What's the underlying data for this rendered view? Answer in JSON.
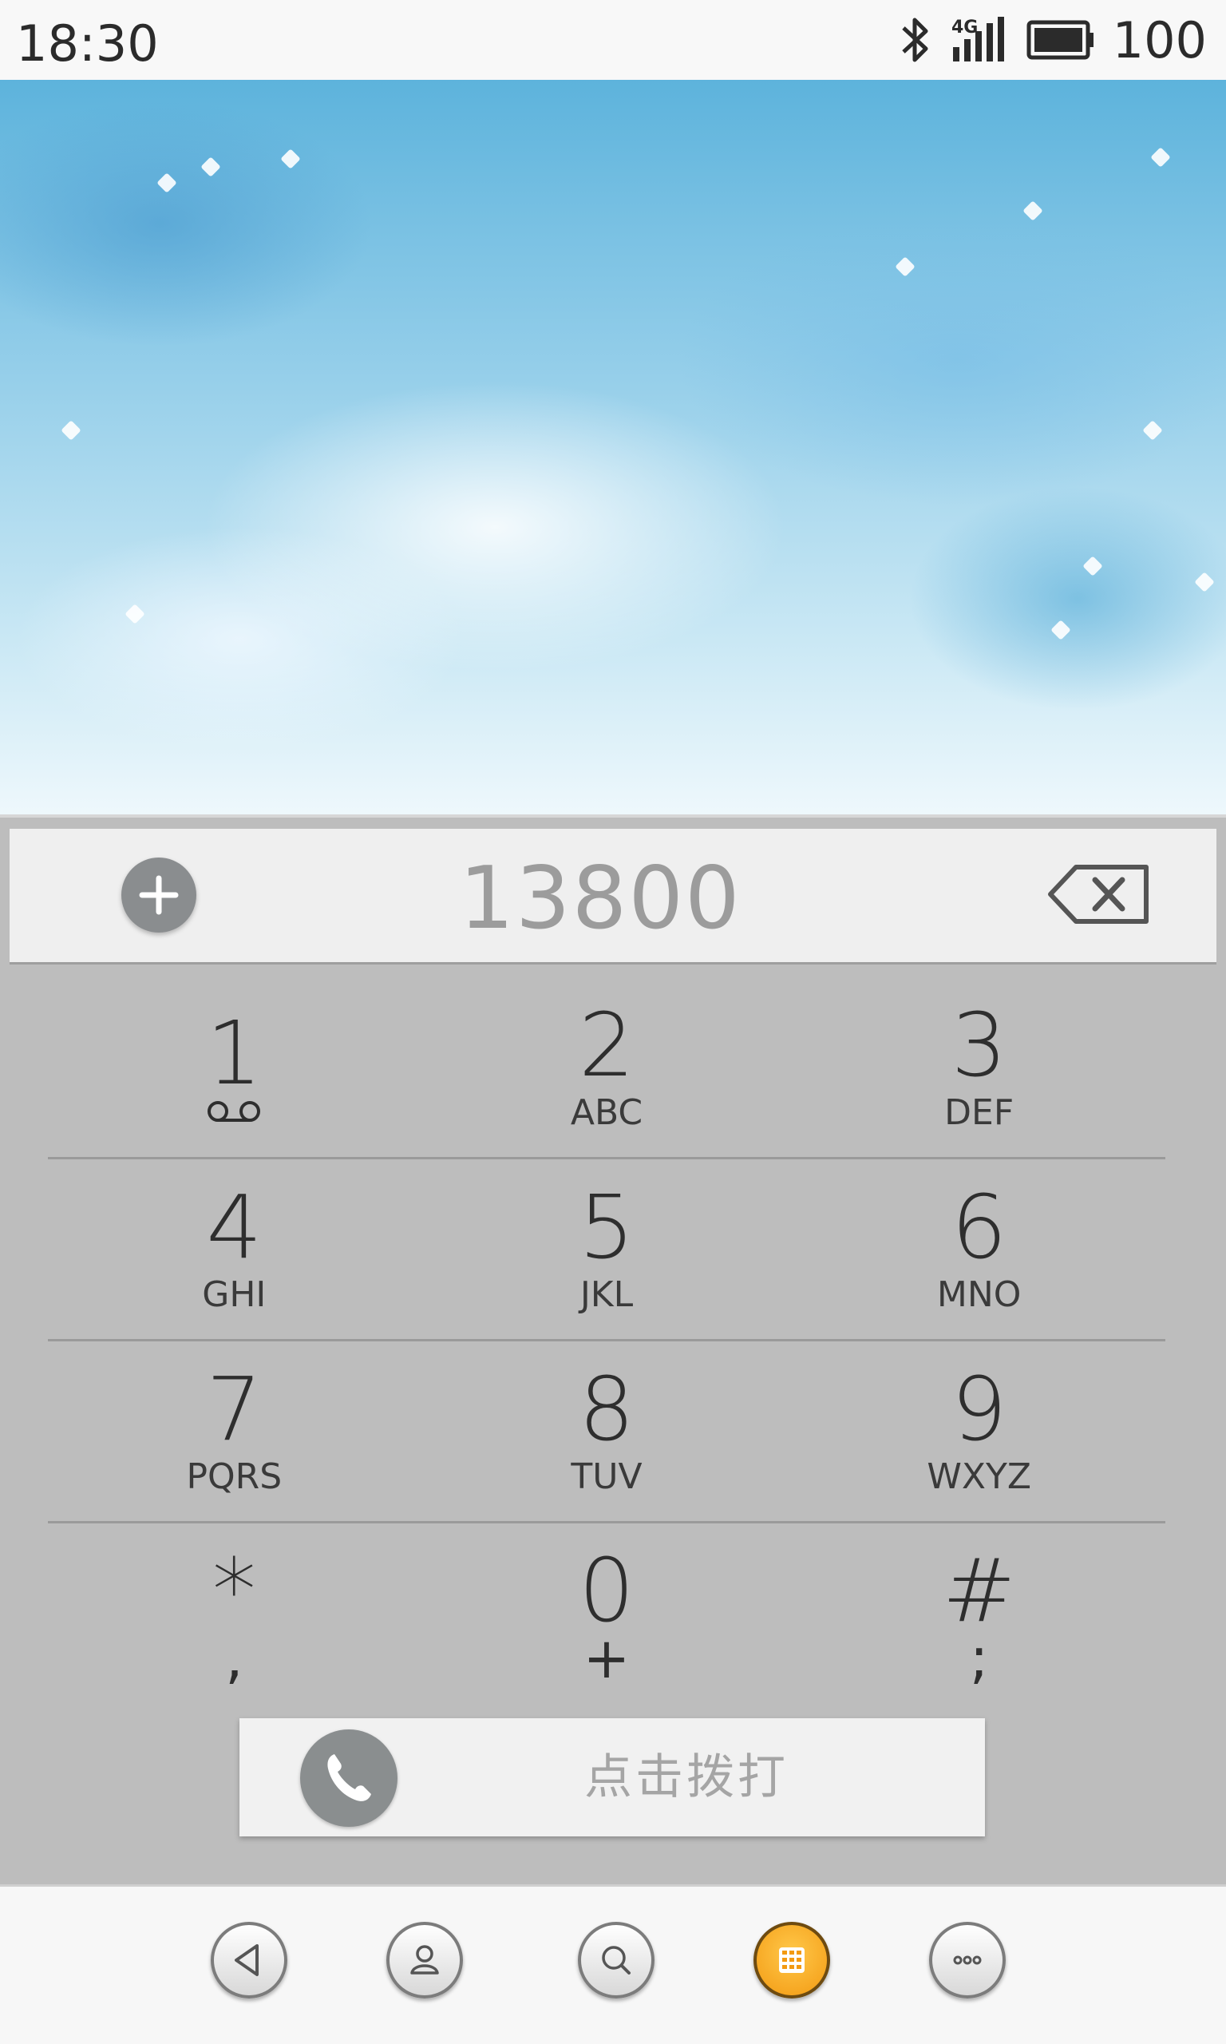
{
  "status_bar": {
    "time": "18:30",
    "network": "4G",
    "battery": "100",
    "icons": [
      "bluetooth-icon",
      "signal-icon",
      "battery-icon"
    ]
  },
  "dialer": {
    "number": "13800",
    "add_icon": "plus-circle-icon",
    "backspace_icon": "backspace-icon",
    "keys": [
      [
        {
          "digit": "1",
          "letters": "",
          "sub_icon": "voicemail-icon"
        },
        {
          "digit": "2",
          "letters": "ABC"
        },
        {
          "digit": "3",
          "letters": "DEF"
        }
      ],
      [
        {
          "digit": "4",
          "letters": "GHI"
        },
        {
          "digit": "5",
          "letters": "JKL"
        },
        {
          "digit": "6",
          "letters": "MNO"
        }
      ],
      [
        {
          "digit": "7",
          "letters": "PQRS"
        },
        {
          "digit": "8",
          "letters": "TUV"
        },
        {
          "digit": "9",
          "letters": "WXYZ"
        }
      ],
      [
        {
          "digit": "*",
          "sub": ","
        },
        {
          "digit": "0",
          "sub": "+"
        },
        {
          "digit": "#",
          "sub": ";"
        }
      ]
    ],
    "call_label": "点击拨打",
    "call_icon": "phone-icon"
  },
  "bottom_nav": {
    "items": [
      "back-icon",
      "contacts-icon",
      "search-icon",
      "dialpad-icon",
      "more-icon"
    ],
    "active": "dialpad-icon",
    "accent": "#f39a12"
  }
}
